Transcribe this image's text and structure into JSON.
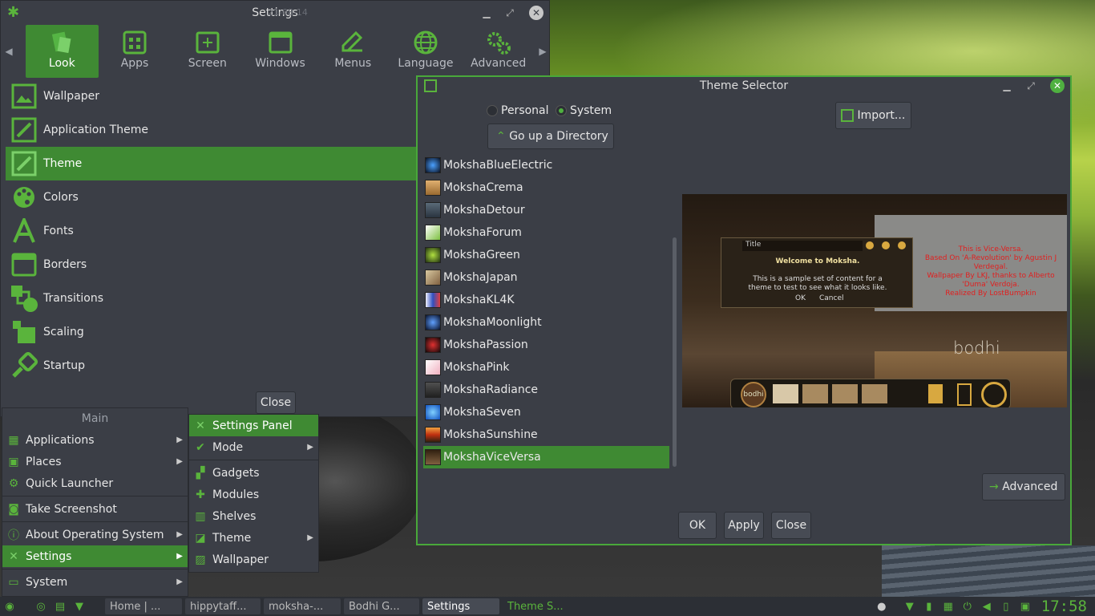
{
  "desktop": {
    "wallpaper_watermark": "21-08-14"
  },
  "settings": {
    "title": "Settings",
    "tabs": [
      {
        "label": "Look",
        "icon": "look-icon"
      },
      {
        "label": "Apps",
        "icon": "apps-icon"
      },
      {
        "label": "Screen",
        "icon": "screen-icon"
      },
      {
        "label": "Windows",
        "icon": "windows-icon"
      },
      {
        "label": "Menus",
        "icon": "menus-icon"
      },
      {
        "label": "Language",
        "icon": "language-icon"
      },
      {
        "label": "Advanced",
        "icon": "advanced-icon"
      }
    ],
    "items": [
      {
        "label": "Wallpaper"
      },
      {
        "label": "Application Theme"
      },
      {
        "label": "Theme"
      },
      {
        "label": "Colors"
      },
      {
        "label": "Fonts"
      },
      {
        "label": "Borders"
      },
      {
        "label": "Transitions"
      },
      {
        "label": "Scaling"
      },
      {
        "label": "Startup"
      }
    ],
    "close_label": "Close"
  },
  "theme_selector": {
    "title": "Theme Selector",
    "radio_personal": "Personal",
    "radio_system": "System",
    "go_up_label": "Go up a Directory",
    "import_label": "Import...",
    "themes": [
      "MokshaBlueElectric",
      "MokshaCrema",
      "MokshaDetour",
      "MokshaForum",
      "MokshaGreen",
      "MokshaJapan",
      "MokshaKL4K",
      "MokshaMoonlight",
      "MokshaPassion",
      "MokshaPink",
      "MokshaRadiance",
      "MokshaSeven",
      "MokshaSunshine",
      "MokshaViceVersa"
    ],
    "selected_theme": "MokshaViceVersa",
    "preview": {
      "dialog_title": "Title",
      "welcome": "Welcome to Moksha.",
      "body_line1": "This is a sample set of content for a",
      "body_line2": "theme to test to see what it looks like.",
      "ok": "OK",
      "cancel": "Cancel",
      "credits": [
        "This is Vice-Versa.",
        "Based On 'A-Revolution' by Agustin J",
        "Verdegal.",
        "Wallpaper By LKJ, thanks to  Alberto",
        "'Duma' Verdoja.",
        "Realized By  LostBumpkin"
      ],
      "bodhi_logo": "bodhi",
      "shelf_logo": "bodhi"
    },
    "advanced_label": "Advanced",
    "ok_label": "OK",
    "apply_label": "Apply",
    "close_label": "Close"
  },
  "main_menu": {
    "header": "Main",
    "items": [
      "Applications",
      "Places",
      "Quick Launcher",
      "Take Screenshot",
      "About Operating System",
      "Settings",
      "System"
    ]
  },
  "settings_submenu": {
    "items": [
      "Settings Panel",
      "Mode",
      "Gadgets",
      "Modules",
      "Shelves",
      "Theme",
      "Wallpaper"
    ]
  },
  "taskbar": {
    "tasks": [
      "Home | ...",
      "hippytaff...",
      "moksha-...",
      "Bodhi G...",
      "Settings",
      "Theme S..."
    ],
    "clock": "17:58"
  },
  "colors": {
    "accent": "#3f8a33",
    "window_bg": "#3b3e46",
    "panel_bg": "#2c2f35"
  }
}
